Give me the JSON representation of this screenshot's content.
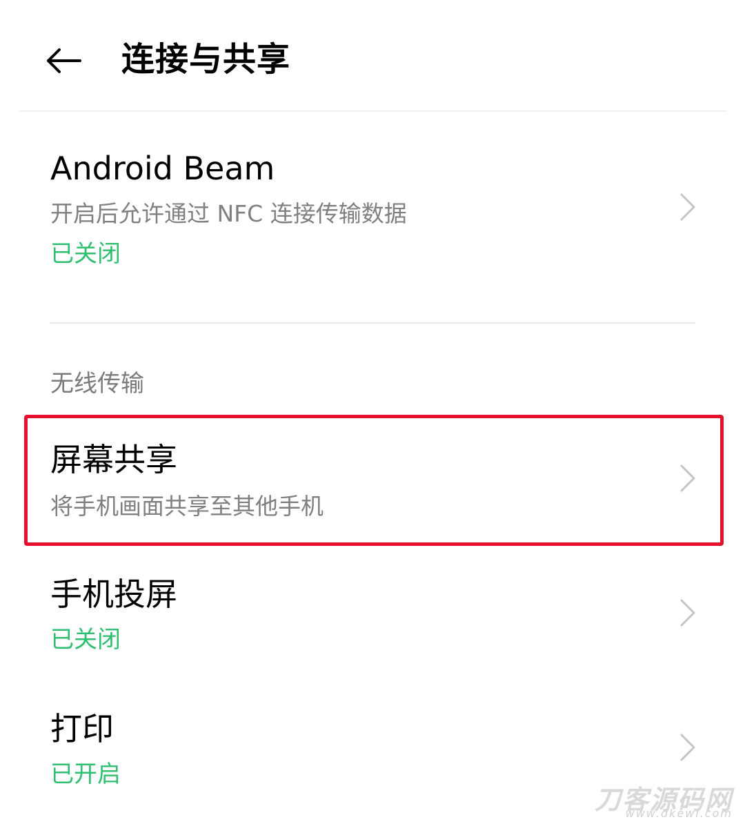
{
  "header": {
    "back_icon": "arrow-left-icon",
    "title": "连接与共享"
  },
  "android_beam": {
    "title": "Android Beam",
    "subtitle": "开启后允许通过 NFC 连接传输数据",
    "status": "已关闭"
  },
  "wireless_section": {
    "header": "无线传输"
  },
  "screen_share": {
    "title": "屏幕共享",
    "subtitle": "将手机画面共享至其他手机"
  },
  "screen_cast": {
    "title": "手机投屏",
    "status": "已关闭"
  },
  "print": {
    "title": "打印",
    "status": "已开启"
  },
  "watermark": {
    "main": "刀客源码网",
    "sub": "www.dkewl.com"
  },
  "colors": {
    "status_green": "#2fbf71",
    "highlight_red": "#e8112d",
    "title_black": "#000000",
    "subtitle_gray": "#7f7f7f"
  }
}
